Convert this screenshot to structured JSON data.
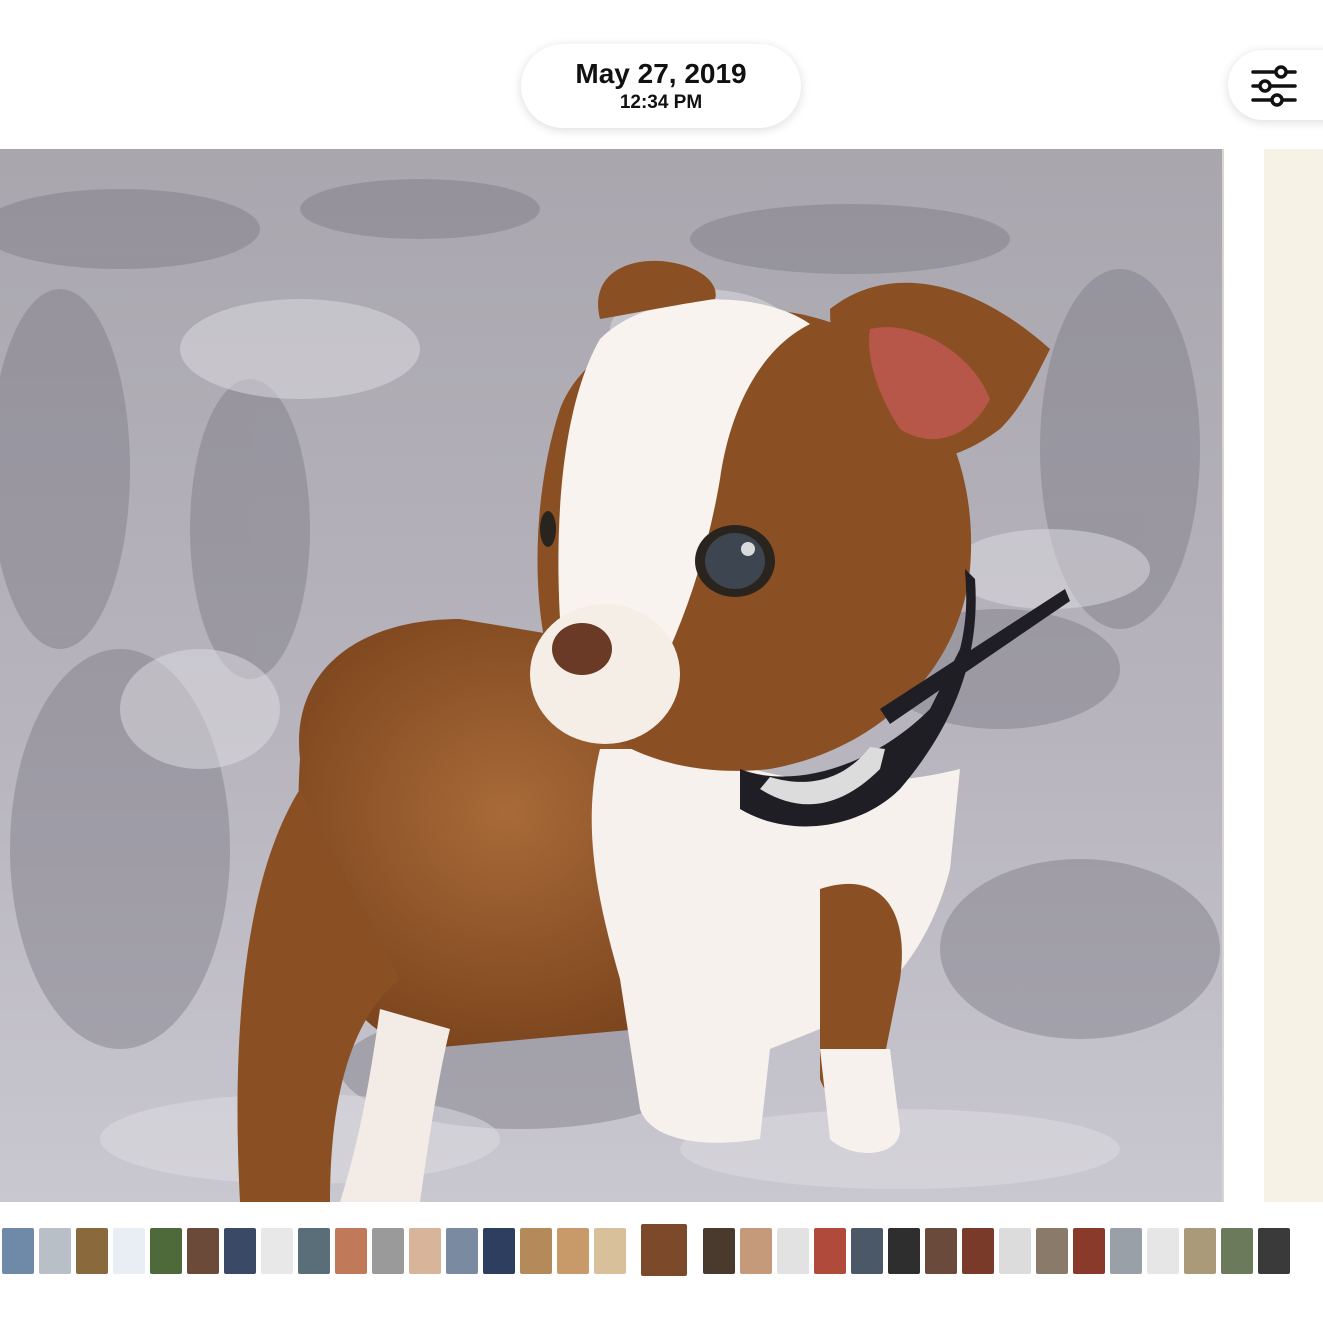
{
  "header": {
    "date": "May 27, 2019",
    "time": "12:34 PM"
  },
  "icons": {
    "adjust": "sliders-icon"
  },
  "photo": {
    "subject": "puppy"
  },
  "colors": {
    "blanket_light": "#c9c6cd",
    "blanket_dark": "#8c8993",
    "fur_brown": "#8a4f22",
    "fur_white": "#f6f1ec"
  },
  "filmstrip": {
    "thumbnails": [
      {
        "color": "#6e8aa8"
      },
      {
        "color": "#b9bfc6"
      },
      {
        "color": "#8a6a3c"
      },
      {
        "color": "#e9eef4"
      },
      {
        "color": "#4e6a3a"
      },
      {
        "color": "#6b4a3a"
      },
      {
        "color": "#3a4a66"
      },
      {
        "color": "#e8e8e8"
      },
      {
        "color": "#5a6e7a"
      },
      {
        "color": "#c07a5a"
      },
      {
        "color": "#9a9a9a"
      },
      {
        "color": "#d8b49a"
      },
      {
        "color": "#7a8aa0"
      },
      {
        "color": "#2e3e5e"
      },
      {
        "color": "#b48a5a"
      },
      {
        "color": "#c89a6a"
      },
      {
        "color": "#d8c09a"
      },
      {
        "color": "#7c4a2a",
        "current": true
      },
      {
        "color": "#4a3a2e"
      },
      {
        "color": "#c49a7a"
      },
      {
        "color": "#e2e2e2"
      },
      {
        "color": "#b04a3a"
      },
      {
        "color": "#4a5868"
      },
      {
        "color": "#2e2e2e"
      },
      {
        "color": "#6a4a3a"
      },
      {
        "color": "#7a3a2a"
      },
      {
        "color": "#dcdcdc"
      },
      {
        "color": "#8a7a6a"
      },
      {
        "color": "#8a3a2a"
      },
      {
        "color": "#9aa0a8"
      },
      {
        "color": "#e6e6e6"
      },
      {
        "color": "#aa9a7a"
      },
      {
        "color": "#6a7a5a"
      },
      {
        "color": "#3a3a3a"
      },
      {
        "color": "#5a4a4a"
      }
    ]
  }
}
